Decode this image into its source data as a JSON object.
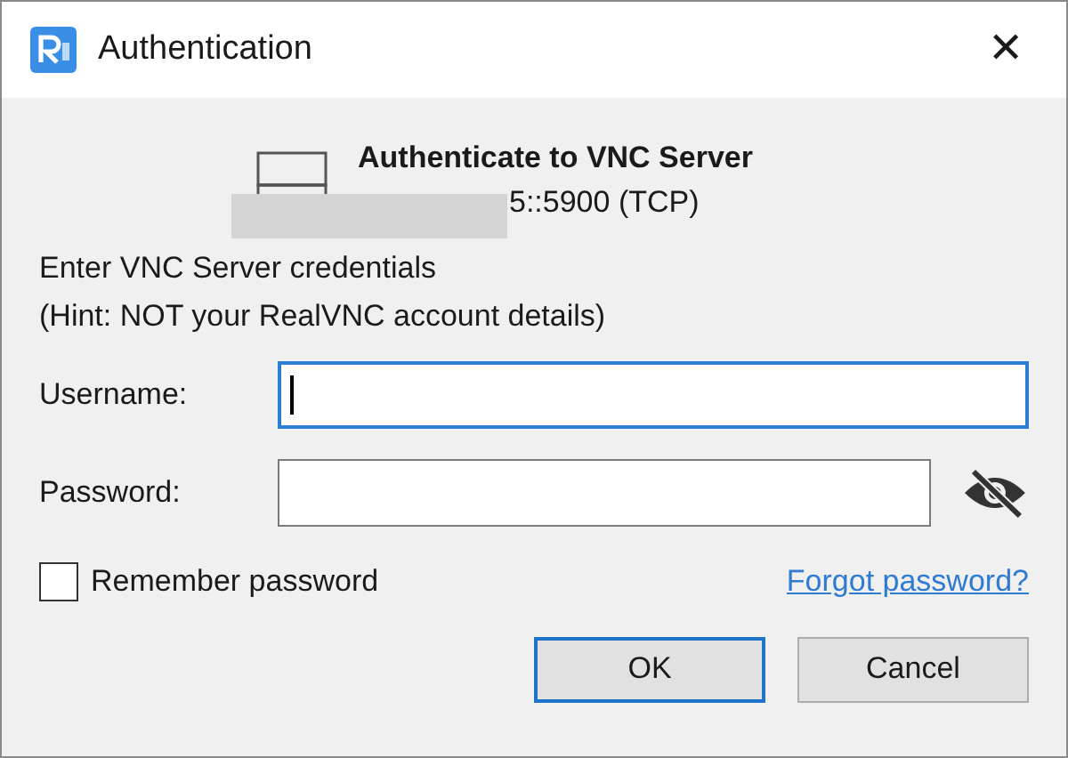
{
  "window": {
    "title": "Authentication",
    "close": "✕"
  },
  "header": {
    "title": "Authenticate to VNC Server",
    "address": "5::5900 (TCP)",
    "redacted": true
  },
  "instructions": [
    "Enter VNC Server credentials",
    "(Hint: NOT your RealVNC account details)"
  ],
  "fields": [
    {
      "label": "Username:",
      "focused": true,
      "kind": "text"
    },
    {
      "label": "Password:",
      "focused": false,
      "kind": "password"
    }
  ],
  "remember": {
    "label": "Remember password",
    "checked": false
  },
  "forgot_link": "Forgot password?",
  "buttons": [
    {
      "label": "OK",
      "default": true
    },
    {
      "label": "Cancel",
      "default": false
    }
  ]
}
